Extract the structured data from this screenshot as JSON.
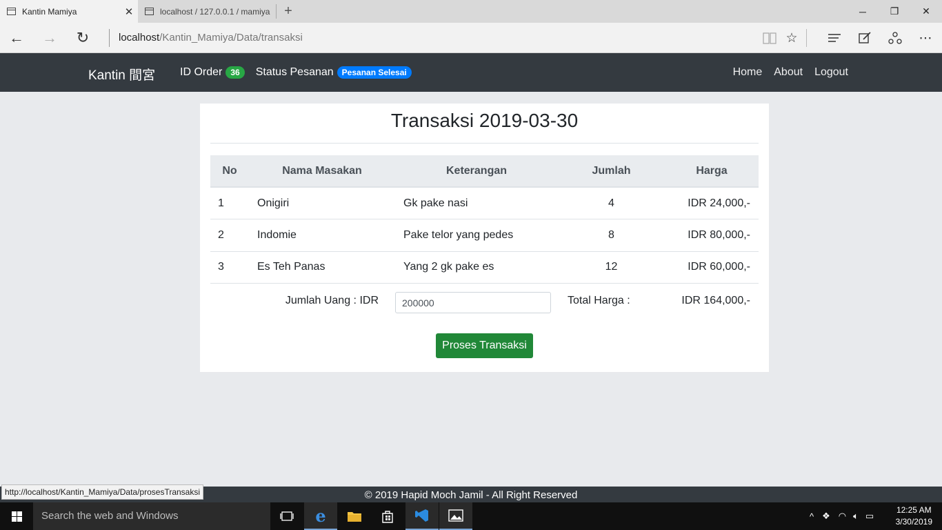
{
  "browser": {
    "tabs": [
      {
        "title": "Kantin Mamiya",
        "active": true
      },
      {
        "title": "localhost / 127.0.0.1 / mamiya",
        "active": false
      }
    ],
    "url_host": "localhost",
    "url_path": "/Kantin_Mamiya/Data/transaksi",
    "status_url": "http://localhost/Kantin_Mamiya/Data/prosesTransaksi"
  },
  "navbar": {
    "brand": "Kantin 間宮",
    "id_order_label": "ID Order",
    "id_order_value": "36",
    "status_label": "Status Pesanan",
    "status_value": "Pesanan Selesai",
    "links": [
      "Home",
      "About",
      "Logout"
    ]
  },
  "page": {
    "title": "Transaksi 2019-03-30",
    "columns": [
      "No",
      "Nama Masakan",
      "Keterangan",
      "Jumlah",
      "Harga"
    ],
    "rows": [
      {
        "no": "1",
        "nama": "Onigiri",
        "keterangan": "Gk pake nasi",
        "jumlah": "4",
        "harga": "IDR 24,000,-"
      },
      {
        "no": "2",
        "nama": "Indomie",
        "keterangan": "Pake telor yang pedes",
        "jumlah": "8",
        "harga": "IDR 80,000,-"
      },
      {
        "no": "3",
        "nama": "Es Teh Panas",
        "keterangan": "Yang 2 gk pake es",
        "jumlah": "12",
        "harga": "IDR 60,000,-"
      }
    ],
    "jumlah_uang_label": "Jumlah Uang : IDR",
    "jumlah_uang_value": "200000",
    "total_label": "Total Harga :",
    "total_value": "IDR 164,000,-",
    "submit_label": "Proses Transaksi"
  },
  "footer": {
    "text": "© 2019 Hapid Moch Jamil - All Right Reserved"
  },
  "taskbar": {
    "search_placeholder": "Search the web and Windows",
    "time": "12:25 AM",
    "date": "3/30/2019"
  },
  "colors": {
    "navbar_bg": "#343a40",
    "badge_green": "#28a745",
    "badge_blue": "#007bff",
    "button_green": "#218838"
  }
}
